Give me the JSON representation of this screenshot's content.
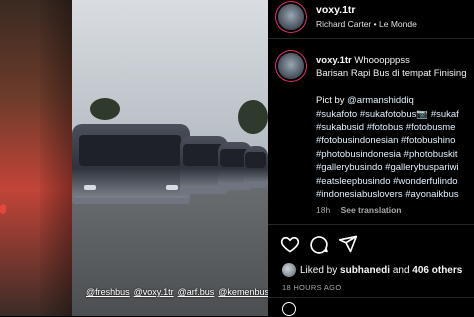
{
  "post": {
    "username": "voxy.1tr",
    "header_sub_user": "Richard Carter",
    "header_sub_sep": "•",
    "header_sub_audio": "Le Monde",
    "caption_lines": [
      {
        "user": "voxy.1tr",
        "text": " Whooopppss"
      },
      {
        "text": "Barisan Rapi Bus di tempat Finising"
      },
      {
        "text": ""
      },
      {
        "text_prefix": "Pict by ",
        "mention": "@armanshiddiq"
      },
      {
        "tags": "#sukafoto #sukafotobus📷 #sukaf"
      },
      {
        "tags": "#sukabusid #fotobus #fotobusme"
      },
      {
        "tags": "#fotobusindonesian #fotobushino"
      },
      {
        "tags": "#photobusindonesia #photobuskit"
      },
      {
        "tags": "#gallerybusindo #gallerybuspariwi"
      },
      {
        "tags": "#eatsleepbusindo #wonderfulindo"
      },
      {
        "tags": "#indonesiabuslovers #ayonaikbus"
      }
    ],
    "meta_time": "18h",
    "meta_translate": "See translation",
    "likes_prefix": "Liked by ",
    "likes_user": "subhanedi",
    "likes_mid": " and ",
    "likes_count": "406 others",
    "timestamp": "18 HOURS AGO"
  },
  "photo": {
    "tags": [
      "@freshbus",
      "@voxy.1tr",
      "@arf.bus",
      "@kemenbus"
    ]
  },
  "icons": [
    "heart-icon",
    "comment-icon",
    "share-icon",
    "emoji-icon"
  ],
  "colors": {
    "story_ring": "#e1306c",
    "panel_bg": "#000000",
    "link": "#e0f1ff"
  }
}
